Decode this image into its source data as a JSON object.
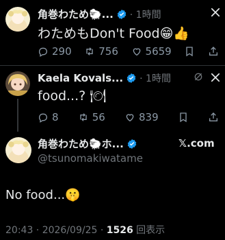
{
  "tweet1": {
    "author": "角巻わため🐑...",
    "time": "· 1時間",
    "text": "わためもDon't Food😁👍",
    "replies": "290",
    "retweets": "756",
    "likes": "5659"
  },
  "tweet2": {
    "author": "Kaela Kovals...",
    "time": "· 1時間",
    "text": "food...? 🍽",
    "replies": "8",
    "retweets": "56",
    "likes": "839"
  },
  "main": {
    "author": "角巻わため🐑ホ...",
    "handle": "@tsunomakiwatame",
    "source": "𝕏.com",
    "text": "No food...🤫",
    "timestamp": "20:43 · 2026/09/25 · ",
    "views": "1526",
    "views_label": " 回表示"
  },
  "colors": {
    "background": "#000000",
    "text": "#e7e9ea",
    "muted": "#71767b",
    "verified": "#1d9bf0"
  },
  "icons": [
    "reply-icon",
    "retweet-icon",
    "like-icon",
    "bookmark-icon",
    "share-icon",
    "grok-icon",
    "verified-icon"
  ]
}
